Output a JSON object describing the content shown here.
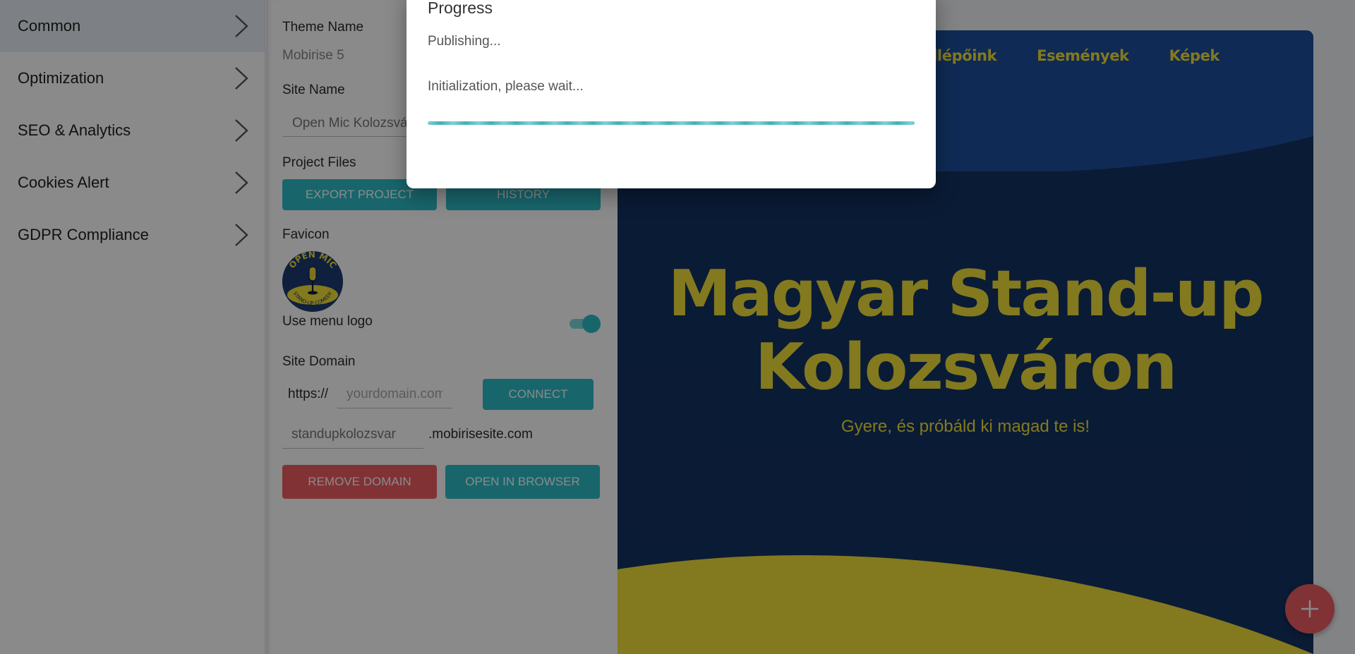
{
  "sidebar": {
    "items": [
      {
        "label": "Common"
      },
      {
        "label": "Optimization"
      },
      {
        "label": "SEO & Analytics"
      },
      {
        "label": "Cookies Alert"
      },
      {
        "label": "GDPR Compliance"
      }
    ]
  },
  "panel": {
    "theme_name_label": "Theme Name",
    "theme_name_value": "Mobirise 5",
    "site_name_label": "Site Name",
    "site_name_value": "Open Mic Kolozsvár",
    "project_files_label": "Project Files",
    "export_button": "EXPORT PROJECT",
    "history_button": "HISTORY",
    "favicon_label": "Favicon",
    "favicon_text_top": "OPEN MIC",
    "favicon_text_bottom": "STAND-UP COMEDY",
    "use_menu_logo_label": "Use menu logo",
    "use_menu_logo_on": true,
    "site_domain_label": "Site Domain",
    "https_prefix": "https://",
    "domain_placeholder": "yourdomain.com",
    "connect_button": "CONNECT",
    "subdomain_value": "standupkolozsvar",
    "subdomain_suffix": ".mobirisesite.com",
    "remove_domain_button": "REMOVE DOMAIN",
    "open_browser_button": "OPEN IN BROWSER"
  },
  "preview": {
    "nav": [
      "Fellépőink",
      "Események",
      "Képek"
    ],
    "hero_title_line1": "Magyar Stand-up",
    "hero_title_line2": "Kolozsváron",
    "hero_subtitle": "Gyere, és próbáld ki magad te is!"
  },
  "fab": {
    "icon": "plus-icon"
  },
  "modal": {
    "title": "Progress",
    "status": "Publishing...",
    "message": "Initialization, please wait..."
  },
  "colors": {
    "accent": "#2ebdc7",
    "danger": "#ef5d63",
    "hero_bg": "#143263",
    "hero_text": "#f3e03a"
  }
}
